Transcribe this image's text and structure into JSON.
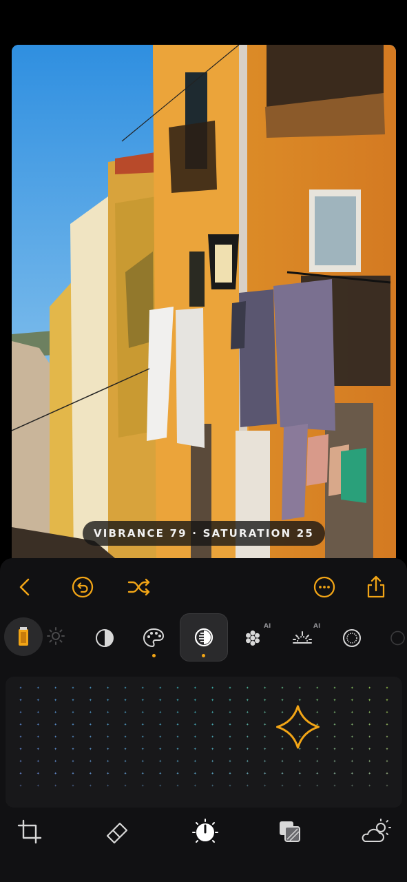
{
  "photo": {
    "caption": "VIBRANCE 79 · SATURATION 25"
  },
  "toolbar": {
    "back_icon": "chevron-left-icon",
    "undo_icon": "undo-circle-icon",
    "shuffle_icon": "shuffle-icon",
    "more_icon": "more-circle-icon",
    "share_icon": "share-icon"
  },
  "tools": [
    {
      "icon": "film-roll-icon",
      "state": "active-preset"
    },
    {
      "icon": "exposure-sun-icon"
    },
    {
      "icon": "contrast-icon"
    },
    {
      "icon": "palette-icon",
      "dot": true
    },
    {
      "icon": "color-vibrance-icon",
      "selected": true,
      "dot": true
    },
    {
      "icon": "flower-icon",
      "badge": "AI"
    },
    {
      "icon": "sunrise-icon",
      "badge": "AI"
    },
    {
      "icon": "vignette-icon"
    }
  ],
  "grid": {
    "columns": 22,
    "rows": 9,
    "marker": {
      "vibrance": 79,
      "saturation": 25
    }
  },
  "bottom_nav": [
    {
      "icon": "crop-icon"
    },
    {
      "icon": "eraser-icon"
    },
    {
      "icon": "adjust-dial-icon",
      "active": true
    },
    {
      "icon": "layers-icon"
    },
    {
      "icon": "weather-sky-icon"
    }
  ],
  "colors": {
    "accent": "#f2a516",
    "panel": "#111113",
    "grid_bg": "#18181a",
    "icon_gray": "#d8d8d8"
  }
}
